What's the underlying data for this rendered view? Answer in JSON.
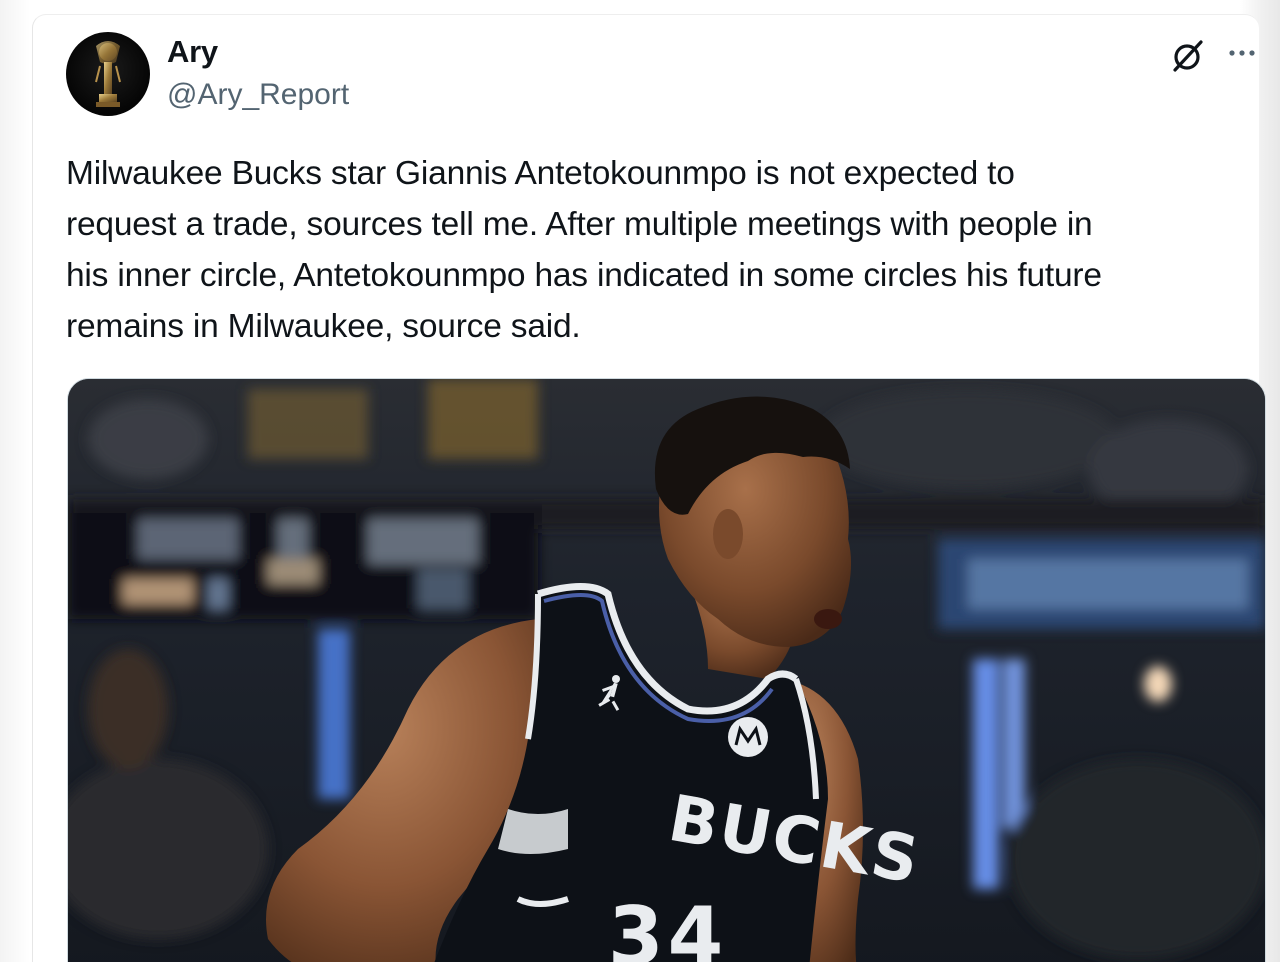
{
  "author": {
    "name": "Ary",
    "handle": "@Ary_Report"
  },
  "tweet": {
    "text": "Milwaukee Bucks star Giannis Antetokounmpo is not expected to\nrequest a trade, sources tell me. After multiple meetings with people in\nhis inner circle, Antetokounmpo has indicated in some circles his future\nremains in Milwaukee, source said."
  },
  "media": {
    "jersey_team": "BUCKS",
    "jersey_number": "34"
  },
  "icons": {
    "grok": "grok-icon",
    "more": "more-icon"
  },
  "colors": {
    "text_primary": "#0f1419",
    "text_secondary": "#536471",
    "jersey": "#0d1117"
  }
}
